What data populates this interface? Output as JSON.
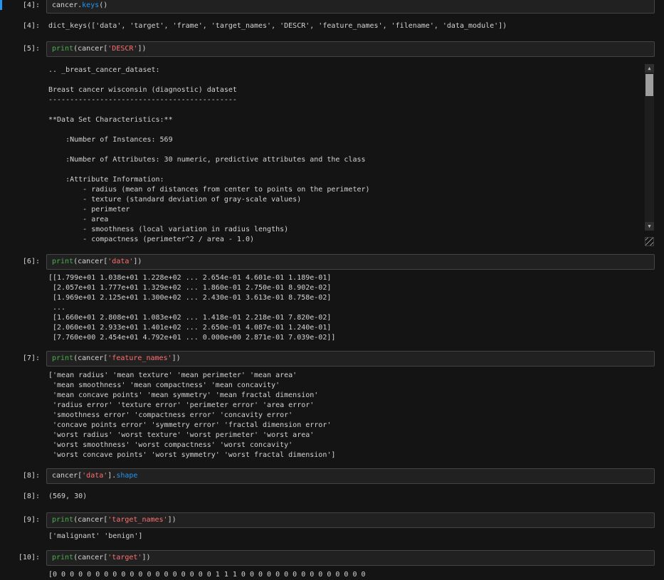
{
  "theme": {
    "page_bg": "#141414",
    "cell_bg": "#212121",
    "cell_border": "#454545",
    "text_color": "#d4d4d4",
    "prompt_color": "#d8d8d8",
    "builtin_color": "#4caf50",
    "string_color": "#ff7070",
    "property_color": "#2196f3",
    "accent_color": "#2196f3",
    "scrollbar_track": "#1e1e1e",
    "scrollbar_thumb": "#9e9e9e",
    "scrollbar_btn": "#2f2f2f",
    "grip_color": "#8a8a8a"
  },
  "icons": {
    "scroll_up": "▲",
    "scroll_down": "▼"
  },
  "cells": {
    "in4": {
      "prompt": "[4]:",
      "tokens": [
        {
          "type": "plain",
          "text": "cancer."
        },
        {
          "type": "property",
          "text": "keys"
        },
        {
          "type": "plain",
          "text": "()"
        }
      ]
    },
    "out4": {
      "prompt": "[4]:",
      "text": "dict_keys(['data', 'target', 'frame', 'target_names', 'DESCR', 'feature_names', 'filename', 'data_module'])"
    },
    "in5": {
      "prompt": "[5]:",
      "tokens": [
        {
          "type": "builtin",
          "text": "print"
        },
        {
          "type": "plain",
          "text": "(cancer["
        },
        {
          "type": "string",
          "text": "'DESCR'"
        },
        {
          "type": "plain",
          "text": "])"
        }
      ]
    },
    "out5": {
      "text": ".. _breast_cancer_dataset:\n\nBreast cancer wisconsin (diagnostic) dataset\n--------------------------------------------\n\n**Data Set Characteristics:**\n\n    :Number of Instances: 569\n\n    :Number of Attributes: 30 numeric, predictive attributes and the class\n\n    :Attribute Information:\n        - radius (mean of distances from center to points on the perimeter)\n        - texture (standard deviation of gray-scale values)\n        - perimeter\n        - area\n        - smoothness (local variation in radius lengths)\n        - compactness (perimeter^2 / area - 1.0)"
    },
    "in6": {
      "prompt": "[6]:",
      "tokens": [
        {
          "type": "builtin",
          "text": "print"
        },
        {
          "type": "plain",
          "text": "(cancer["
        },
        {
          "type": "string",
          "text": "'data'"
        },
        {
          "type": "plain",
          "text": "])"
        }
      ]
    },
    "out6": {
      "text": "[[1.799e+01 1.038e+01 1.228e+02 ... 2.654e-01 4.601e-01 1.189e-01]\n [2.057e+01 1.777e+01 1.329e+02 ... 1.860e-01 2.750e-01 8.902e-02]\n [1.969e+01 2.125e+01 1.300e+02 ... 2.430e-01 3.613e-01 8.758e-02]\n ...\n [1.660e+01 2.808e+01 1.083e+02 ... 1.418e-01 2.218e-01 7.820e-02]\n [2.060e+01 2.933e+01 1.401e+02 ... 2.650e-01 4.087e-01 1.240e-01]\n [7.760e+00 2.454e+01 4.792e+01 ... 0.000e+00 2.871e-01 7.039e-02]]"
    },
    "in7": {
      "prompt": "[7]:",
      "tokens": [
        {
          "type": "builtin",
          "text": "print"
        },
        {
          "type": "plain",
          "text": "(cancer["
        },
        {
          "type": "string",
          "text": "'feature_names'"
        },
        {
          "type": "plain",
          "text": "])"
        }
      ]
    },
    "out7": {
      "text": "['mean radius' 'mean texture' 'mean perimeter' 'mean area'\n 'mean smoothness' 'mean compactness' 'mean concavity'\n 'mean concave points' 'mean symmetry' 'mean fractal dimension'\n 'radius error' 'texture error' 'perimeter error' 'area error'\n 'smoothness error' 'compactness error' 'concavity error'\n 'concave points error' 'symmetry error' 'fractal dimension error'\n 'worst radius' 'worst texture' 'worst perimeter' 'worst area'\n 'worst smoothness' 'worst compactness' 'worst concavity'\n 'worst concave points' 'worst symmetry' 'worst fractal dimension']"
    },
    "in8": {
      "prompt": "[8]:",
      "tokens": [
        {
          "type": "plain",
          "text": "cancer["
        },
        {
          "type": "string",
          "text": "'data'"
        },
        {
          "type": "plain",
          "text": "]."
        },
        {
          "type": "property",
          "text": "shape"
        }
      ]
    },
    "out8": {
      "prompt": "[8]:",
      "text": "(569, 30)"
    },
    "in9": {
      "prompt": "[9]:",
      "tokens": [
        {
          "type": "builtin",
          "text": "print"
        },
        {
          "type": "plain",
          "text": "(cancer["
        },
        {
          "type": "string",
          "text": "'target_names'"
        },
        {
          "type": "plain",
          "text": "])"
        }
      ]
    },
    "out9": {
      "text": "['malignant' 'benign']"
    },
    "in10": {
      "prompt": "[10]:",
      "tokens": [
        {
          "type": "builtin",
          "text": "print"
        },
        {
          "type": "plain",
          "text": "(cancer["
        },
        {
          "type": "string",
          "text": "'target'"
        },
        {
          "type": "plain",
          "text": "])"
        }
      ]
    },
    "out10": {
      "text": "[0 0 0 0 0 0 0 0 0 0 0 0 0 0 0 0 0 0 0 1 1 1 0 0 0 0 0 0 0 0 0 0 0 0 0 0 0"
    }
  }
}
